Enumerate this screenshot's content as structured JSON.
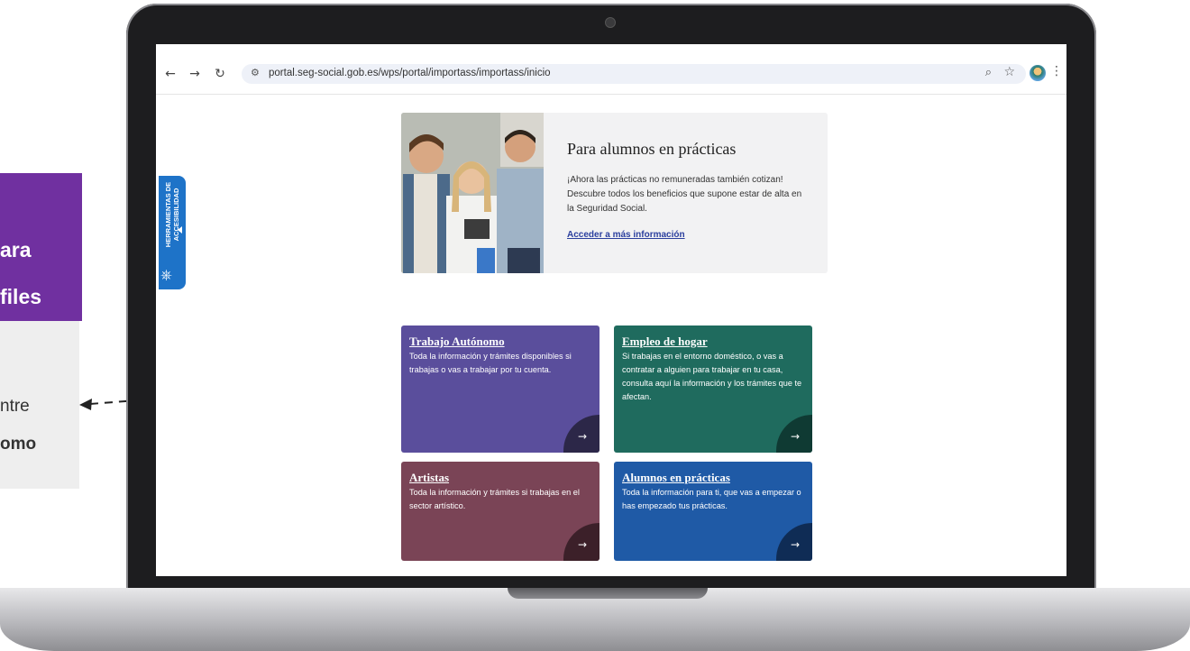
{
  "overlay": {
    "purple_line1": "ara",
    "purple_line2": "files",
    "grey_line1": "ntre",
    "grey_line2": "omo"
  },
  "browser": {
    "back_icon": "arrow-left-icon",
    "forward_icon": "arrow-right-icon",
    "reload_icon": "reload-icon",
    "url": "portal.seg-social.gob.es/wps/portal/importass/importass/inicio",
    "zoom_icon": "zoom-icon",
    "bookmark_icon": "star-icon",
    "menu_icon": "kebab-menu-icon"
  },
  "accessibility_tab": {
    "label": "HERRAMIENTAS DE ACCESIBILIDAD",
    "icon": "accessibility-wheel-icon"
  },
  "hero": {
    "title": "Para alumnos en prácticas",
    "text": "¡Ahora las prácticas no remuneradas también cotizan! Descubre todos los beneficios que supone estar de alta en la Seguridad Social.",
    "link": "Acceder a más información"
  },
  "tiles": [
    {
      "title": "Trabajo Autónomo",
      "description": "Toda la información y trámites disponibles si trabajas o vas a trabajar por tu cuenta.",
      "arrow": "→",
      "color": "#5a4e9c",
      "corner_color": "#2c2748"
    },
    {
      "title": "Empleo de hogar",
      "description": "Si trabajas en el entorno doméstico, o vas a contratar a alguien para trabajar en tu casa, consulta aquí la información y los trámites que te afectan.",
      "arrow": "→",
      "color": "#1f6b5e",
      "corner_color": "#0f3a33"
    },
    {
      "title": "Artistas",
      "description": "Toda la información y trámites si trabajas en el sector artístico.",
      "arrow": "→",
      "color": "#7a4456",
      "corner_color": "#3c2029"
    },
    {
      "title": "Alumnos en prácticas",
      "description": "Toda la información para ti, que vas a empezar o has empezado tus prácticas.",
      "arrow": "→",
      "color": "#1f5aa6",
      "corner_color": "#0f2c55"
    }
  ]
}
